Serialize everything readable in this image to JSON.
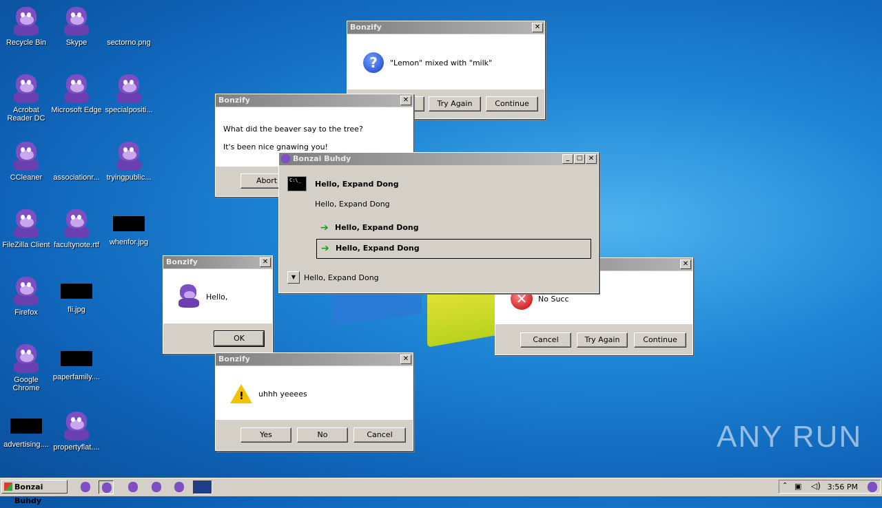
{
  "desktop": {
    "icons": [
      {
        "label": "Recycle Bin",
        "kind": "bonzi"
      },
      {
        "label": "Skype",
        "kind": "bonzi"
      },
      {
        "label": "sectorno.png",
        "kind": "blank"
      },
      {
        "label": "Acrobat Reader DC",
        "kind": "bonzi"
      },
      {
        "label": "Microsoft Edge",
        "kind": "bonzi"
      },
      {
        "label": "specialpositi...",
        "kind": "bonzi"
      },
      {
        "label": "CCleaner",
        "kind": "bonzi"
      },
      {
        "label": "associationr...",
        "kind": "blank"
      },
      {
        "label": "tryingpublic...",
        "kind": "bonzi"
      },
      {
        "label": "FileZilla Client",
        "kind": "bonzi"
      },
      {
        "label": "facultynote.rtf",
        "kind": "bonzi"
      },
      {
        "label": "whenfor.jpg",
        "kind": "black"
      },
      {
        "label": "Firefox",
        "kind": "bonzi"
      },
      {
        "label": "fli.jpg",
        "kind": "black"
      },
      {
        "label": "Google Chrome",
        "kind": "bonzi"
      },
      {
        "label": "paperfamily....",
        "kind": "black"
      },
      {
        "label": "advertising....",
        "kind": "black"
      },
      {
        "label": "propertyflat....",
        "kind": "bonzi"
      }
    ],
    "watermark": "ANY RUN"
  },
  "dialogs": {
    "lemon": {
      "title": "Bonzify",
      "message": "\"Lemon\" mixed with \"milk\"",
      "icon": "question-icon",
      "buttons": [
        "Try Again",
        "Continue"
      ]
    },
    "beaver": {
      "title": "Bonzify",
      "line1": "What did the beaver say to the tree?",
      "line2": "It's been nice gnawing you!",
      "buttons": [
        "Abort"
      ]
    },
    "buhdy": {
      "title": "Bonzai Buhdy",
      "heading": "Hello, Expand Dong",
      "subtext": "Hello, Expand Dong",
      "option1": "Hello, Expand Dong",
      "option2": "Hello, Expand Dong",
      "footer": "Hello, Expand Dong",
      "cmd_text": "C:\\_"
    },
    "nosucc": {
      "message": "No Succ",
      "icon": "error-icon",
      "buttons": [
        "Cancel",
        "Try Again",
        "Continue"
      ]
    },
    "hello": {
      "title": "Bonzify",
      "message": "Hello,",
      "button": "OK"
    },
    "uhhh": {
      "title": "Bonzify",
      "message": "uhhh yeeees",
      "icon": "warning-icon",
      "buttons": [
        "Yes",
        "No",
        "Cancel"
      ]
    }
  },
  "taskbar": {
    "start_label": "Bonzai Buhdy",
    "clock": "3:56 PM"
  }
}
